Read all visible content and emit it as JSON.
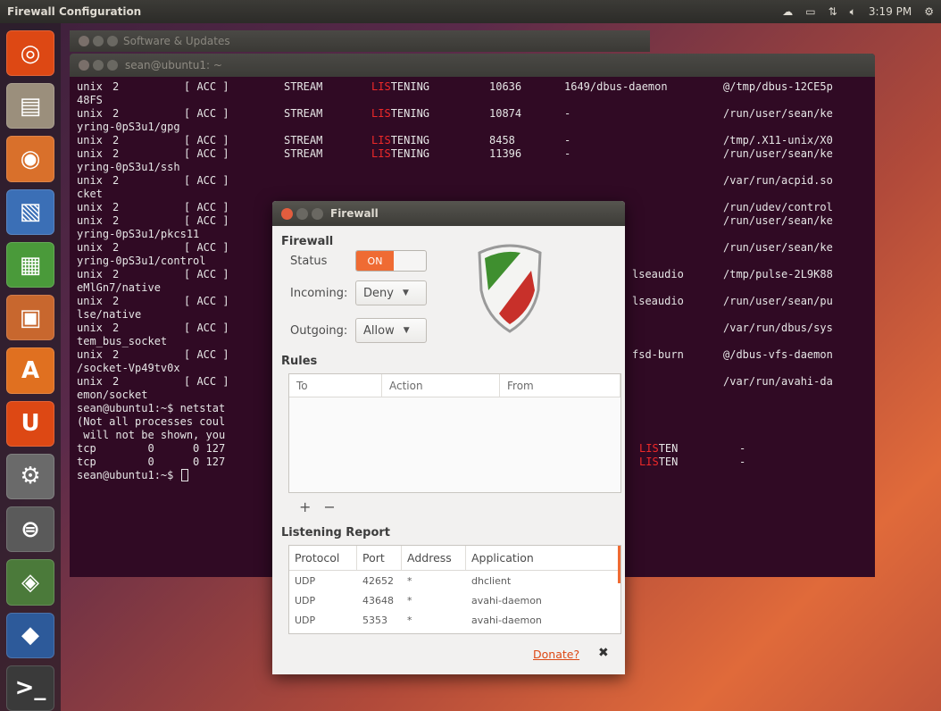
{
  "top_panel": {
    "title": "Firewall Configuration",
    "time": "3:19 PM"
  },
  "launcher": {
    "items": [
      {
        "icon": "ubuntu-dash-icon",
        "glyph": "◎",
        "bg": "#dd4814"
      },
      {
        "icon": "files-icon",
        "glyph": "▤",
        "bg": "#9b8f7c"
      },
      {
        "icon": "firefox-icon",
        "glyph": "◉",
        "bg": "#d9702b"
      },
      {
        "icon": "writer-icon",
        "glyph": "▧",
        "bg": "#3b6fb6"
      },
      {
        "icon": "calc-icon",
        "glyph": "▦",
        "bg": "#4a9a3a"
      },
      {
        "icon": "impress-icon",
        "glyph": "▣",
        "bg": "#c8672e"
      },
      {
        "icon": "software-center-icon",
        "glyph": "A",
        "bg": "#e07020"
      },
      {
        "icon": "ubuntu-one-icon",
        "glyph": "U",
        "bg": "#dd4814"
      },
      {
        "icon": "system-settings-icon",
        "glyph": "⚙",
        "bg": "#6a6a6a"
      },
      {
        "icon": "software-updater-icon",
        "glyph": "⊜",
        "bg": "#5a5a5a"
      },
      {
        "icon": "workspace-switcher-icon",
        "glyph": "◈",
        "bg": "#4b7a3a"
      },
      {
        "icon": "firewall-icon",
        "glyph": "◆",
        "bg": "#2d5a9a"
      },
      {
        "icon": "terminal-icon",
        "glyph": ">_",
        "bg": "#3a3a3a"
      }
    ]
  },
  "software_updates_window": {
    "title": "Software & Updates"
  },
  "terminal": {
    "title": "sean@ubuntu1: ~",
    "rows": [
      {
        "proto": "unix",
        "refcnt": "2",
        "flags": "[ ACC ]",
        "type": "STREAM",
        "state_pre": "LIS",
        "state_post": "TENING",
        "inode": "10636",
        "pid": "1649/dbus-daemon",
        "path": "@/tmp/dbus-12CE5p"
      },
      {
        "wrap": "48FS"
      },
      {
        "proto": "unix",
        "refcnt": "2",
        "flags": "[ ACC ]",
        "type": "STREAM",
        "state_pre": "LIS",
        "state_post": "TENING",
        "inode": "10874",
        "pid": "-",
        "path": "/run/user/sean/ke"
      },
      {
        "wrap": "yring-0pS3u1/gpg"
      },
      {
        "proto": "unix",
        "refcnt": "2",
        "flags": "[ ACC ]",
        "type": "STREAM",
        "state_pre": "LIS",
        "state_post": "TENING",
        "inode": "8458",
        "pid": "-",
        "path": "/tmp/.X11-unix/X0"
      },
      {
        "proto": "unix",
        "refcnt": "2",
        "flags": "[ ACC ]",
        "type": "STREAM",
        "state_pre": "LIS",
        "state_post": "TENING",
        "inode": "11396",
        "pid": "-",
        "path": "/run/user/sean/ke"
      },
      {
        "wrap": "yring-0pS3u1/ssh"
      },
      {
        "proto": "unix",
        "refcnt": "2",
        "flags": "[ ACC ]",
        "type": "",
        "state_pre": "",
        "state_post": "",
        "inode": "",
        "pid": "",
        "path": "/var/run/acpid.so"
      },
      {
        "wrap": "cket"
      },
      {
        "proto": "unix",
        "refcnt": "2",
        "flags": "[ ACC ]",
        "type": "",
        "state_pre": "",
        "state_post": "",
        "inode": "",
        "pid": "",
        "path": "/run/udev/control"
      },
      {
        "proto": "unix",
        "refcnt": "2",
        "flags": "[ ACC ]",
        "type": "",
        "state_pre": "",
        "state_post": "",
        "inode": "",
        "pid": "",
        "path": "/run/user/sean/ke"
      },
      {
        "wrap": "yring-0pS3u1/pkcs11"
      },
      {
        "proto": "unix",
        "refcnt": "2",
        "flags": "[ ACC ]",
        "type": "",
        "state_pre": "",
        "state_post": "",
        "inode": "",
        "pid": "",
        "path": "/run/user/sean/ke"
      },
      {
        "wrap": "yring-0pS3u1/control"
      },
      {
        "proto": "unix",
        "refcnt": "2",
        "flags": "[ ACC ]",
        "type": "",
        "state_pre": "",
        "state_post": "",
        "inode": "",
        "pid": "lseaudio",
        "path": "/tmp/pulse-2L9K88"
      },
      {
        "wrap": "eMlGn7/native"
      },
      {
        "proto": "unix",
        "refcnt": "2",
        "flags": "[ ACC ]",
        "type": "",
        "state_pre": "",
        "state_post": "",
        "inode": "",
        "pid": "lseaudio",
        "path": "/run/user/sean/pu"
      },
      {
        "wrap": "lse/native"
      },
      {
        "proto": "unix",
        "refcnt": "2",
        "flags": "[ ACC ]",
        "type": "",
        "state_pre": "",
        "state_post": "",
        "inode": "",
        "pid": "",
        "path": "/var/run/dbus/sys"
      },
      {
        "wrap": "tem_bus_socket"
      },
      {
        "proto": "unix",
        "refcnt": "2",
        "flags": "[ ACC ]",
        "type": "",
        "state_pre": "",
        "state_post": "",
        "inode": "",
        "pid": "fsd-burn",
        "path": "@/dbus-vfs-daemon"
      },
      {
        "wrap": "/socket-Vp49tv0x"
      },
      {
        "proto": "unix",
        "refcnt": "2",
        "flags": "[ ACC ]",
        "type": "",
        "state_pre": "",
        "state_post": "",
        "inode": "",
        "pid": "",
        "path": "/var/run/avahi-da"
      },
      {
        "wrap": "emon/socket"
      },
      {
        "wrap": "sean@ubuntu1:~$ netstat"
      },
      {
        "wrap": "(Not all processes coul"
      },
      {
        "wrap": " will not be shown, you"
      },
      {
        "tcp": "tcp        0      0 127",
        "state_pre": "LIS",
        "state_post": "TEN",
        "pid": "-"
      },
      {
        "tcp": "tcp        0      0 127",
        "state_pre": "LIS",
        "state_post": "TEN",
        "pid": "-"
      },
      {
        "wrap": "sean@ubuntu1:~$ ",
        "cursor": true
      }
    ]
  },
  "firewall": {
    "title": "Firewall",
    "section_firewall": "Firewall",
    "status_label": "Status",
    "status_value": "ON",
    "incoming_label": "Incoming:",
    "incoming_value": "Deny",
    "outgoing_label": "Outgoing:",
    "outgoing_value": "Allow",
    "section_rules": "Rules",
    "rules_columns": [
      "To",
      "Action",
      "From"
    ],
    "add_label": "+",
    "remove_label": "−",
    "section_report": "Listening Report",
    "report_columns": [
      "Protocol",
      "Port",
      "Address",
      "Application"
    ],
    "report_rows": [
      {
        "protocol": "UDP",
        "port": "42652",
        "address": "*",
        "application": "dhclient"
      },
      {
        "protocol": "UDP",
        "port": "43648",
        "address": "*",
        "application": "avahi-daemon"
      },
      {
        "protocol": "UDP",
        "port": "5353",
        "address": "*",
        "application": "avahi-daemon"
      }
    ],
    "donate_label": "Donate?",
    "close_label": "✖"
  }
}
